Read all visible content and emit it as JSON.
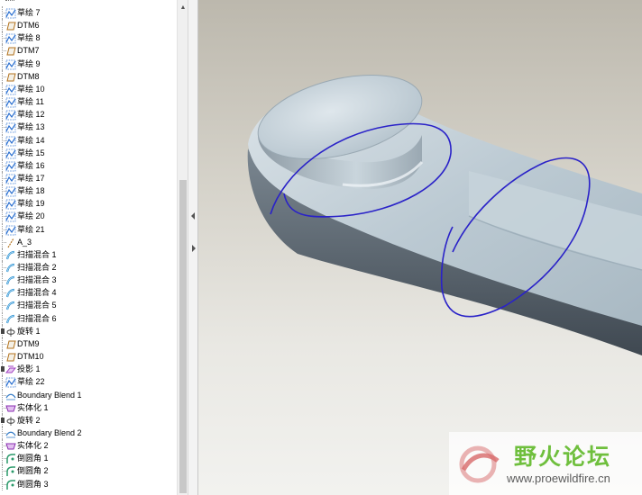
{
  "tree": {
    "items": [
      {
        "label": "草绘 7",
        "type": "sketch"
      },
      {
        "label": "DTM6",
        "type": "datum"
      },
      {
        "label": "草绘 8",
        "type": "sketch"
      },
      {
        "label": "DTM7",
        "type": "datum"
      },
      {
        "label": "草绘 9",
        "type": "sketch"
      },
      {
        "label": "DTM8",
        "type": "datum"
      },
      {
        "label": "草绘 10",
        "type": "sketch"
      },
      {
        "label": "草绘 11",
        "type": "sketch"
      },
      {
        "label": "草绘 12",
        "type": "sketch"
      },
      {
        "label": "草绘 13",
        "type": "sketch"
      },
      {
        "label": "草绘 14",
        "type": "sketch"
      },
      {
        "label": "草绘 15",
        "type": "sketch"
      },
      {
        "label": "草绘 16",
        "type": "sketch"
      },
      {
        "label": "草绘 17",
        "type": "sketch"
      },
      {
        "label": "草绘 18",
        "type": "sketch"
      },
      {
        "label": "草绘 19",
        "type": "sketch"
      },
      {
        "label": "草绘 20",
        "type": "sketch"
      },
      {
        "label": "草绘 21",
        "type": "sketch"
      },
      {
        "label": "A_3",
        "type": "axis"
      },
      {
        "label": "扫描混合 1",
        "type": "sweep"
      },
      {
        "label": "扫描混合 2",
        "type": "sweep"
      },
      {
        "label": "扫描混合 3",
        "type": "sweep"
      },
      {
        "label": "扫描混合 4",
        "type": "sweep"
      },
      {
        "label": "扫描混合 5",
        "type": "sweep"
      },
      {
        "label": "扫描混合 6",
        "type": "sweep"
      },
      {
        "label": "旋转 1",
        "type": "revolve",
        "expandable": true
      },
      {
        "label": "DTM9",
        "type": "datum"
      },
      {
        "label": "DTM10",
        "type": "datum"
      },
      {
        "label": "投影 1",
        "type": "project",
        "expandable": true
      },
      {
        "label": "草绘 22",
        "type": "sketch"
      },
      {
        "label": "Boundary Blend 1",
        "type": "blend"
      },
      {
        "label": "实体化 1",
        "type": "solidify"
      },
      {
        "label": "旋转 2",
        "type": "revolve",
        "expandable": true
      },
      {
        "label": "Boundary Blend 2",
        "type": "blend"
      },
      {
        "label": "实体化 2",
        "type": "solidify"
      },
      {
        "label": "倒圆角 1",
        "type": "round"
      },
      {
        "label": "倒圆角 2",
        "type": "round"
      },
      {
        "label": "倒圆角 3",
        "type": "round"
      }
    ]
  },
  "scrollbar": {
    "up_glyph": "▲"
  },
  "viewport": {
    "model": "3d-part-handle",
    "annotation_color": "#2a22c8"
  },
  "watermark": {
    "title": "野火论坛",
    "url": "www.proewildfire.cn"
  },
  "colors": {
    "viewport_top": "#bcb8ad",
    "viewport_bottom": "#f2f2ef",
    "part_surface": "#b8c6cf",
    "part_dark": "#55606a",
    "watermark_green": "#6fbf3d"
  }
}
